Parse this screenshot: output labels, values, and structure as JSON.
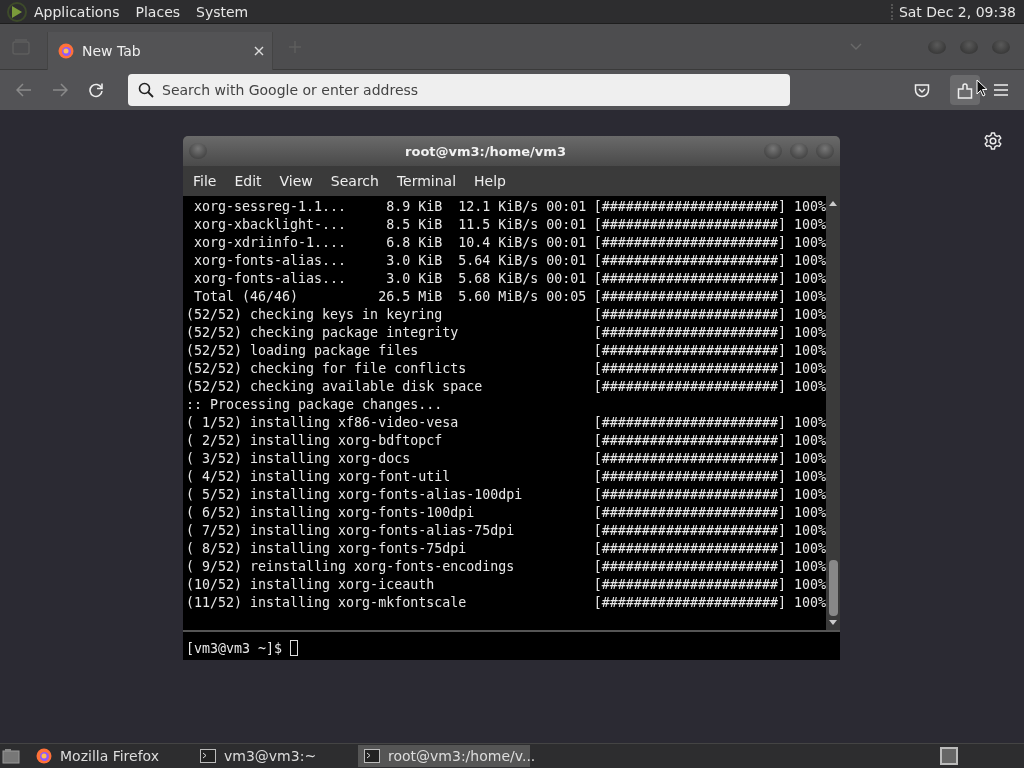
{
  "top_panel": {
    "menus": [
      "Applications",
      "Places",
      "System"
    ],
    "clock": "Sat Dec  2, 09:38"
  },
  "browser": {
    "tabs": [
      {
        "label": "New Tab",
        "selected": true
      }
    ],
    "address_bar": {
      "placeholder": "Search with Google or enter address"
    }
  },
  "terminal": {
    "title": "root@vm3:/home/vm3",
    "menu": [
      "File",
      "Edit",
      "View",
      "Search",
      "Terminal",
      "Help"
    ],
    "lines": [
      {
        "text": " xorg-sessreg-1.1...     8.9 KiB  12.1 KiB/s 00:01",
        "progress": "[######################]",
        "percent": "100%"
      },
      {
        "text": " xorg-xbacklight-...     8.5 KiB  11.5 KiB/s 00:01",
        "progress": "[######################]",
        "percent": "100%"
      },
      {
        "text": " xorg-xdriinfo-1....     6.8 KiB  10.4 KiB/s 00:01",
        "progress": "[######################]",
        "percent": "100%"
      },
      {
        "text": " xorg-fonts-alias...     3.0 KiB  5.64 KiB/s 00:01",
        "progress": "[######################]",
        "percent": "100%"
      },
      {
        "text": " xorg-fonts-alias...     3.0 KiB  5.68 KiB/s 00:01",
        "progress": "[######################]",
        "percent": "100%"
      },
      {
        "text": " Total (46/46)          26.5 MiB  5.60 MiB/s 00:05",
        "progress": "[######################]",
        "percent": "100%"
      },
      {
        "text": "(52/52) checking keys in keyring",
        "progress": "[######################]",
        "percent": "100%"
      },
      {
        "text": "(52/52) checking package integrity",
        "progress": "[######################]",
        "percent": "100%"
      },
      {
        "text": "(52/52) loading package files",
        "progress": "[######################]",
        "percent": "100%"
      },
      {
        "text": "(52/52) checking for file conflicts",
        "progress": "[######################]",
        "percent": "100%"
      },
      {
        "text": "(52/52) checking available disk space",
        "progress": "[######################]",
        "percent": "100%"
      },
      {
        "text": ":: Processing package changes..."
      },
      {
        "text": "( 1/52) installing xf86-video-vesa",
        "progress": "[######################]",
        "percent": "100%"
      },
      {
        "text": "( 2/52) installing xorg-bdftopcf",
        "progress": "[######################]",
        "percent": "100%"
      },
      {
        "text": "( 3/52) installing xorg-docs",
        "progress": "[######################]",
        "percent": "100%"
      },
      {
        "text": "( 4/52) installing xorg-font-util",
        "progress": "[######################]",
        "percent": "100%"
      },
      {
        "text": "( 5/52) installing xorg-fonts-alias-100dpi",
        "progress": "[######################]",
        "percent": "100%"
      },
      {
        "text": "( 6/52) installing xorg-fonts-100dpi",
        "progress": "[######################]",
        "percent": "100%"
      },
      {
        "text": "( 7/52) installing xorg-fonts-alias-75dpi",
        "progress": "[######################]",
        "percent": "100%"
      },
      {
        "text": "( 8/52) installing xorg-fonts-75dpi",
        "progress": "[######################]",
        "percent": "100%"
      },
      {
        "text": "( 9/52) reinstalling xorg-fonts-encodings",
        "progress": "[######################]",
        "percent": "100%"
      },
      {
        "text": "(10/52) installing xorg-iceauth",
        "progress": "[######################]",
        "percent": "100%"
      },
      {
        "text": "(11/52) installing xorg-mkfontscale",
        "progress": "[######################]",
        "percent": "100%"
      }
    ],
    "lower_pane": {
      "prompt": "[vm3@vm3 ~]$"
    }
  },
  "taskbar": {
    "items": [
      {
        "kind": "browser",
        "label": "Mozilla Firefox",
        "selected": false
      },
      {
        "kind": "terminal",
        "label": "vm3@vm3:~",
        "selected": false
      },
      {
        "kind": "terminal",
        "label": "root@vm3:/home/v...",
        "selected": true
      }
    ]
  }
}
